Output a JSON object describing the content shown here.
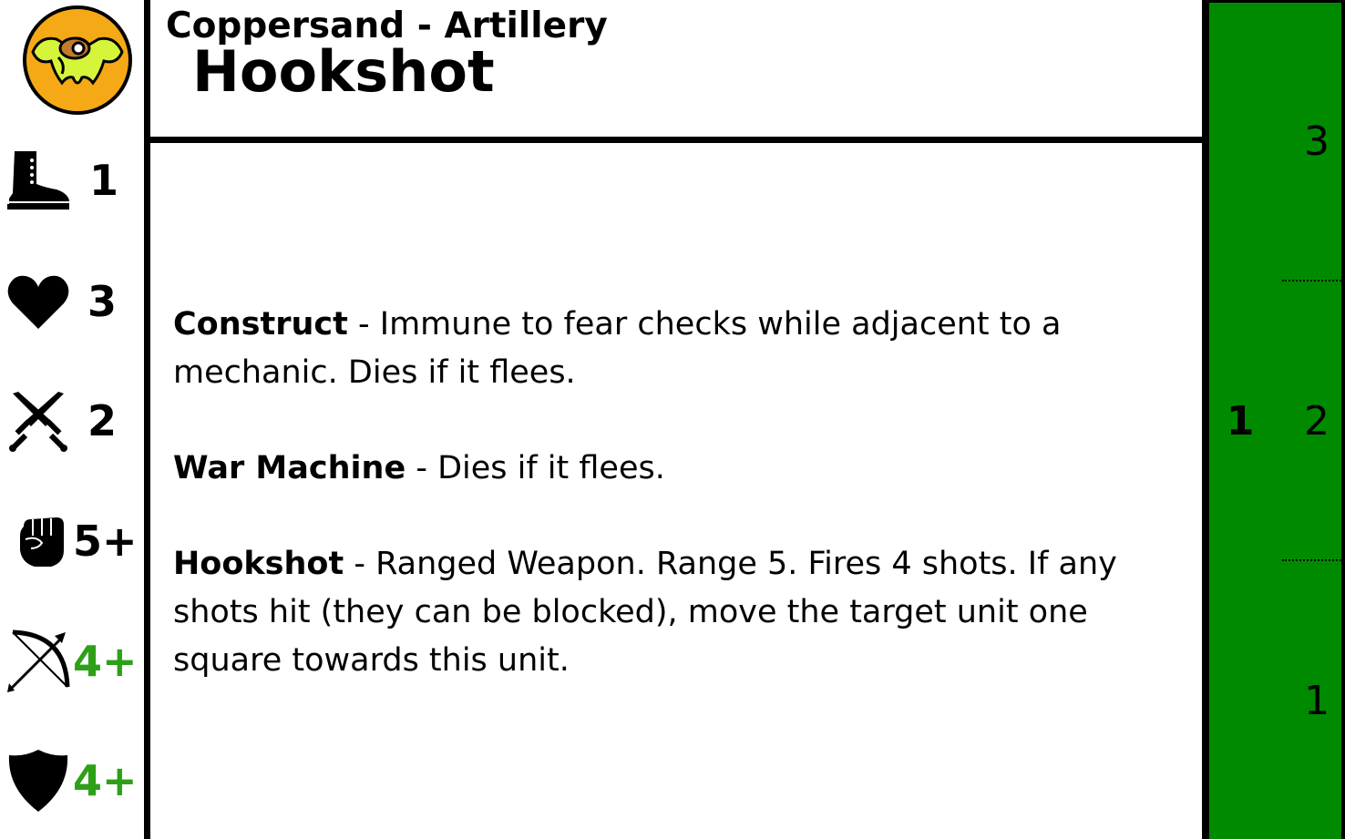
{
  "card": {
    "faction": "Coppersand - Artillery",
    "name": "Hookshot"
  },
  "stats": {
    "movement": {
      "icon": "boot-icon",
      "value": "1"
    },
    "health": {
      "icon": "heart-icon",
      "value": "3"
    },
    "melee": {
      "icon": "crossed-swords-icon",
      "value": "2"
    },
    "strength": {
      "icon": "fist-icon",
      "value": "5+"
    },
    "ranged": {
      "icon": "bow-icon",
      "value": "4+"
    },
    "armor": {
      "icon": "shield-icon",
      "value": "4+"
    }
  },
  "rules": [
    {
      "name": "Construct",
      "text": " - Immune to fear checks while adjacent to a mechanic. Dies if it flees."
    },
    {
      "name": "War Machine",
      "text": " - Dies if it flees."
    },
    {
      "name": "Hookshot",
      "text": " - Ranged Weapon. Range 5. Fires 4 shots. If any shots hit (they can be blocked), move the target unit one square towards this unit."
    }
  ],
  "track": {
    "left_value": "1",
    "levels": [
      "3",
      "2",
      "1"
    ]
  },
  "colors": {
    "track_green": "#008a00",
    "stat_green": "#2ea018",
    "emblem_orange": "#f5a916",
    "emblem_lime": "#d6f53a"
  }
}
